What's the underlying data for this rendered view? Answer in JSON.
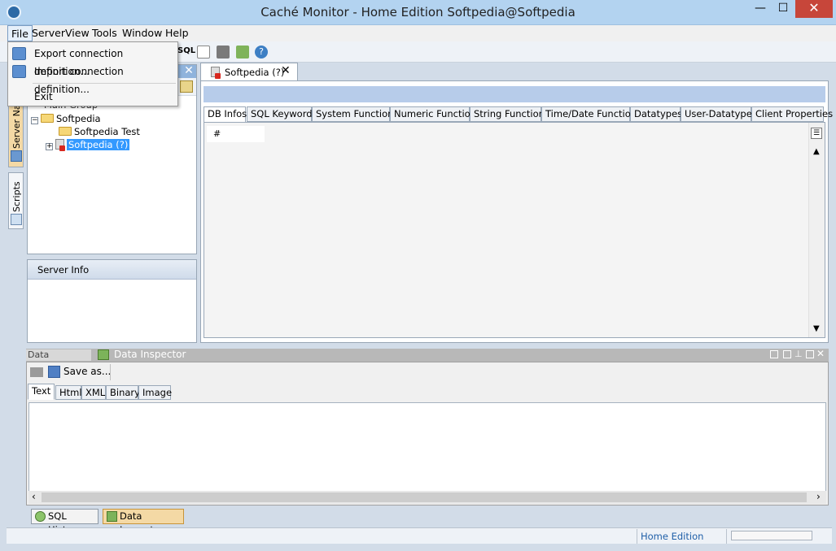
{
  "window": {
    "title": "Caché Monitor - Home Edition  Softpedia@Softpedia",
    "minimize": "—",
    "maximize": "☐",
    "close": "✕"
  },
  "menubar": [
    "File",
    "Server",
    "View",
    "Tools",
    "Window",
    "Help"
  ],
  "file_menu": {
    "export": "Export connection definition...",
    "import": "Import connection definition...",
    "exit": "Exit"
  },
  "sidebar_tabs": [
    "Server Na",
    "Scripts"
  ],
  "tree": {
    "group": "Main Group",
    "nodes": [
      "Softpedia",
      "Softpedia Test",
      "Softpedia (?)"
    ]
  },
  "server_info": {
    "title": "Server Info"
  },
  "editor": {
    "tab_label": "Softpedia (?)",
    "subtabs": [
      "DB Infos",
      "SQL Keywords",
      "System Functions",
      "Numeric Functions",
      "String Functions",
      "Time/Date Functions",
      "Datatypes",
      "User-Datatypes",
      "Client Properties"
    ],
    "grid_header": "#"
  },
  "data_inspector": {
    "tab_inactive": "Data Inspector",
    "tab_active": "Data Inspector",
    "save_as": "Save as...",
    "view_tabs": [
      "Text",
      "Html",
      "XML",
      "Binary",
      "Image"
    ]
  },
  "bottom_buttons": [
    "SQL History",
    "Data Inspector"
  ],
  "status": {
    "edition": "Home Edition"
  },
  "toolbar_text": {
    "sql": "SQL"
  },
  "colors": {
    "accent": "#3399ff",
    "header": "#8fb3dc",
    "active_bottom": "#f4d9a5"
  }
}
